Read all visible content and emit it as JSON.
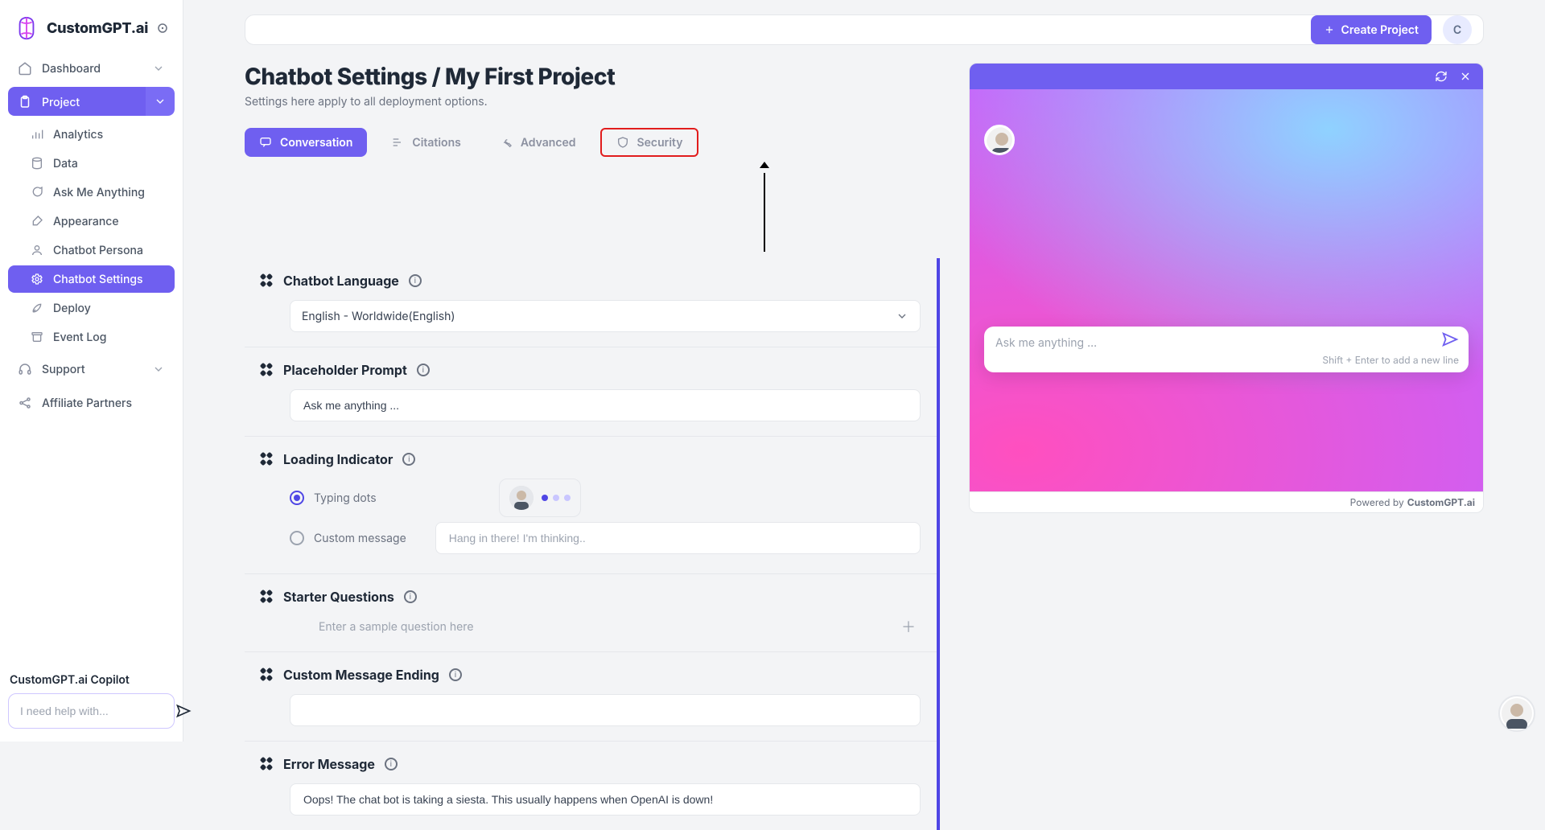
{
  "brand": {
    "name": "CustomGPT.ai"
  },
  "header": {
    "create_label": "Create Project",
    "avatar_letter": "C"
  },
  "sidebar": {
    "dashboard": "Dashboard",
    "project": "Project",
    "items": [
      "Analytics",
      "Data",
      "Ask Me Anything",
      "Appearance",
      "Chatbot Persona",
      "Chatbot Settings",
      "Deploy",
      "Event Log"
    ],
    "support": "Support",
    "affiliate": "Affiliate Partners",
    "copilot_title": "CustomGPT.ai Copilot",
    "copilot_placeholder": "I need help with..."
  },
  "page": {
    "title": "Chatbot Settings / My First Project",
    "subtitle": "Settings here apply to all deployment options."
  },
  "tabs": {
    "conversation": "Conversation",
    "citations": "Citations",
    "advanced": "Advanced",
    "security": "Security"
  },
  "sections": {
    "language": {
      "title": "Chatbot Language",
      "value": "English - Worldwide(English)"
    },
    "placeholder": {
      "title": "Placeholder Prompt",
      "value": "Ask me anything ..."
    },
    "loading": {
      "title": "Loading Indicator",
      "typing_label": "Typing dots",
      "custom_label": "Custom message",
      "custom_placeholder": "Hang in there! I'm thinking.."
    },
    "starter": {
      "title": "Starter Questions",
      "placeholder": "Enter a sample question here"
    },
    "ending": {
      "title": "Custom Message Ending",
      "value": ""
    },
    "error": {
      "title": "Error Message",
      "value": "Oops! The chat bot is taking a siesta. This usually happens when OpenAI is down!"
    }
  },
  "preview": {
    "input_placeholder": "Ask me anything ...",
    "hint": "Shift + Enter to add a new line",
    "powered_text": "Powered by ",
    "powered_brand": "CustomGPT.ai"
  }
}
